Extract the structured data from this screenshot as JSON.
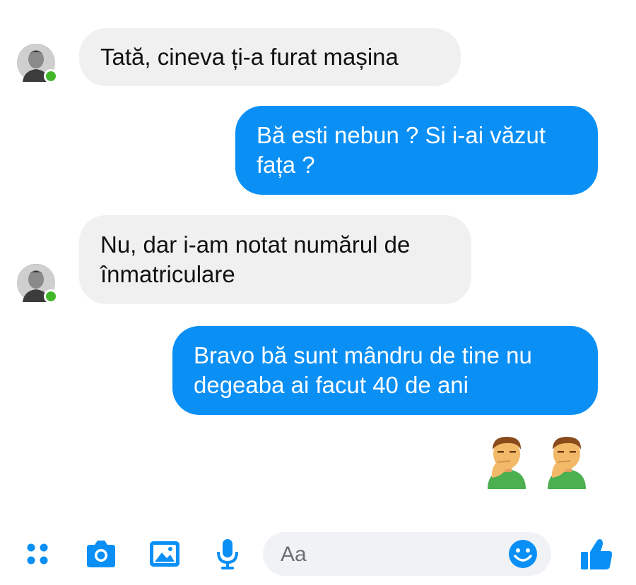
{
  "messages": [
    {
      "side": "in",
      "lines": [
        "Tată, cineva ți-a furat mașina"
      ]
    },
    {
      "side": "out",
      "lines": [
        "Bă esti nebun ? Si i-ai văzut",
        "fața  ?"
      ]
    },
    {
      "side": "in",
      "lines": [
        "Nu, dar i-am notat numărul de",
        "înmatriculare"
      ]
    },
    {
      "side": "out",
      "lines": [
        "Bravo bă sunt mândru de tine nu",
        "degeaba ai facut 40 de ani"
      ]
    }
  ],
  "reactions": {
    "emoji_name": "man-facepalming-emoji",
    "count": 2
  },
  "composer": {
    "placeholder": "Aa",
    "icons": [
      "apps-icon",
      "camera-icon",
      "gallery-icon",
      "microphone-icon",
      "emoji-icon",
      "thumbs-up-icon"
    ]
  },
  "colors": {
    "outgoing_bubble": "#0a8ff5",
    "incoming_bubble": "#f0f0f0",
    "accent": "#0a8ff5",
    "online": "#42b72a"
  }
}
